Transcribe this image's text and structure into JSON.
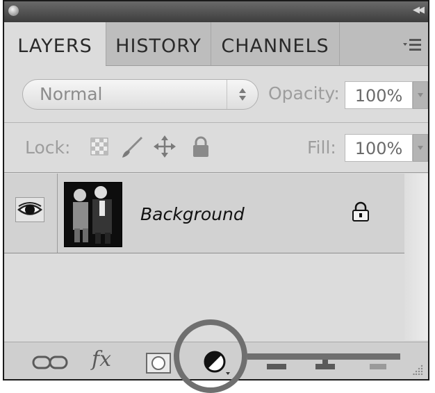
{
  "tabs": [
    "LAYERS",
    "HISTORY",
    "CHANNELS"
  ],
  "blend_mode": "Normal",
  "opacity": {
    "label": "Opacity:",
    "value": "100%"
  },
  "lock": {
    "label": "Lock:"
  },
  "fill": {
    "label": "Fill:",
    "value": "100%"
  },
  "layer": {
    "name": "Background"
  },
  "icons": {
    "close": "close-dot-icon",
    "collapse": "collapse-arrows-icon",
    "menu": "panel-menu-icon",
    "eye": "eye-icon",
    "lock_transparent": "checkerboard-icon",
    "lock_image": "brush-icon",
    "lock_position": "move-icon",
    "lock_all": "padlock-icon",
    "link": "link-layers-icon",
    "fx": "fx-icon",
    "mask": "mask-icon",
    "adjustment": "adjustment-layer-icon",
    "group": "folder-icon",
    "new": "new-layer-icon",
    "delete": "trash-icon"
  },
  "colors": {
    "panel": "#dcdcdc",
    "titlebar": "#3d3d3d",
    "highlight": "#6f6f6f"
  }
}
